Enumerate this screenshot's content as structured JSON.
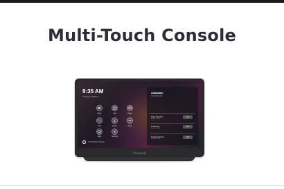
{
  "page": {
    "title": "Multi-Touch Console"
  },
  "device": {
    "brand": "Yealink",
    "screen": {
      "clock": "9:35 AM",
      "date": "Tuesday, March 1",
      "home_icons": [
        {
          "icon": "video-call-icon",
          "label": "Meet"
        },
        {
          "icon": "calendar-icon",
          "label": "Join"
        },
        {
          "icon": "share-icon",
          "label": "Share"
        },
        {
          "icon": "phone-icon",
          "label": "Call"
        },
        {
          "icon": "people-icon",
          "label": "Room"
        },
        {
          "icon": "more-icon",
          "label": "More"
        },
        {
          "icon": "screen-icon",
          "label": "Cast"
        },
        {
          "icon": "settings-icon",
          "label": "Settings"
        }
      ],
      "footer_text": "Yealink Room System",
      "panel": {
        "title": "Available",
        "subtitle": "Until 10:00 AM",
        "meetings": [
          {
            "name": "Daily Standup",
            "time": "10:00 - 10:30",
            "action": "Join"
          },
          {
            "name": "Roadmap",
            "time": "11:00 - 12:00",
            "action": "Join"
          },
          {
            "name": "Design Review",
            "time": "14:00 - 15:00",
            "action": "Join"
          }
        ]
      }
    }
  }
}
